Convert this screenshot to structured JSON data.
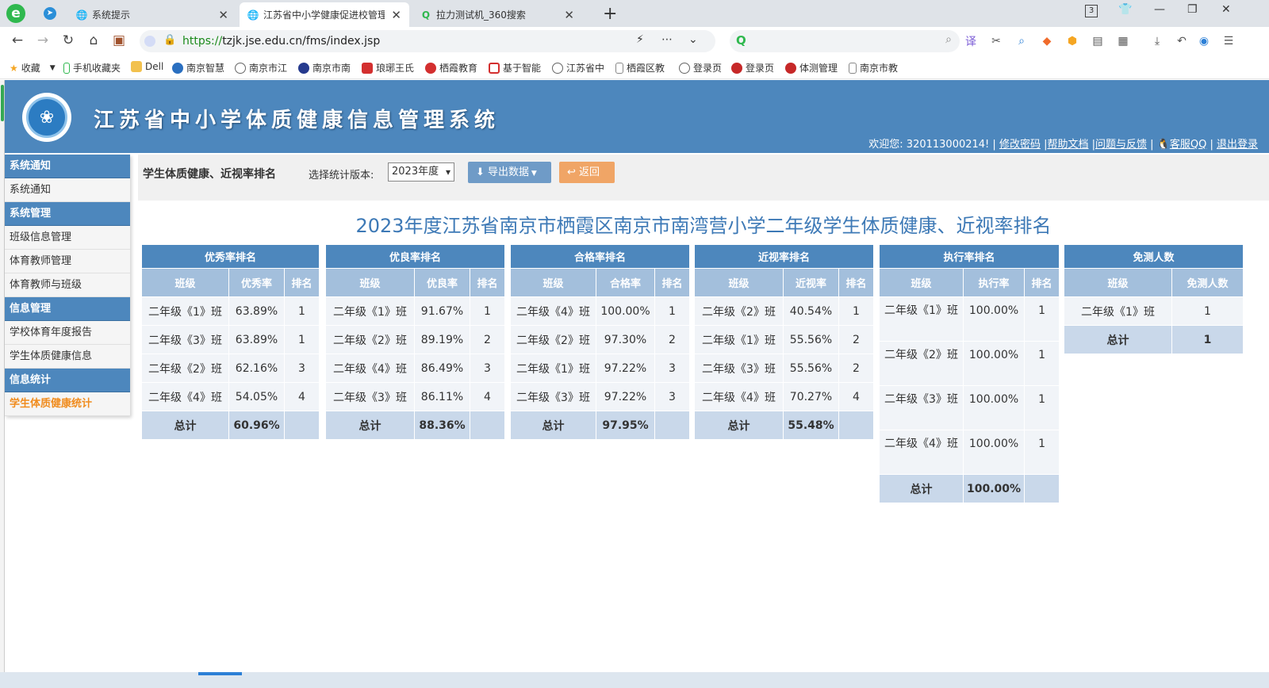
{
  "browser": {
    "tabs": [
      {
        "label": "系统提示",
        "icon": "globe-icon"
      },
      {
        "label": "江苏省中小学健康促进校管理",
        "icon": "globe-icon"
      },
      {
        "label": "拉力测试机_360搜索",
        "icon": "search-360-icon"
      }
    ],
    "tab_count": "3",
    "url_scheme": "https://",
    "url_rest": "tzjk.jse.edu.cn/fms/index.jsp",
    "bookmarks": [
      "收藏",
      "手机收藏夹",
      "Dell",
      "南京智慧",
      "南京市江",
      "南京市南",
      "琅琊王氏",
      "栖霞教育",
      "基于智能",
      "江苏省中",
      "栖霞区教",
      "登录页",
      "登录页",
      "体测管理",
      "南京市教"
    ]
  },
  "header": {
    "system_title": "江苏省中小学体质健康信息管理系统",
    "welcome": "欢迎您: 320113000214! |",
    "links": [
      "修改密码",
      "帮助文档",
      "问题与反馈",
      "客服QQ",
      "退出登录"
    ]
  },
  "sidebar": {
    "groups": [
      {
        "title": "系统通知",
        "items": [
          "系统通知"
        ]
      },
      {
        "title": "系统管理",
        "items": [
          "班级信息管理",
          "体育教师管理",
          "体育教师与班级"
        ]
      },
      {
        "title": "信息管理",
        "items": [
          "学校体育年度报告",
          "学生体质健康信息"
        ]
      },
      {
        "title": "信息统计",
        "items": [
          "学生体质健康统计"
        ]
      }
    ],
    "active_item": "学生体质健康统计"
  },
  "toolbar": {
    "title": "学生体质健康、近视率排名",
    "version_label": "选择统计版本:",
    "version_value": "2023年度",
    "export_label": "导出数据",
    "back_label": "返回"
  },
  "report": {
    "title": "2023年度江苏省南京市栖霞区南京市南湾营小学二年级学生体质健康、近视率排名",
    "tables": [
      {
        "caption": "优秀率排名",
        "headers": [
          "班级",
          "优秀率",
          "排名"
        ],
        "rows": [
          [
            "二年级《1》班",
            "63.89%",
            "1"
          ],
          [
            "二年级《3》班",
            "63.89%",
            "1"
          ],
          [
            "二年级《2》班",
            "62.16%",
            "3"
          ],
          [
            "二年级《4》班",
            "54.05%",
            "4"
          ]
        ],
        "total": [
          "总计",
          "60.96%",
          ""
        ]
      },
      {
        "caption": "优良率排名",
        "headers": [
          "班级",
          "优良率",
          "排名"
        ],
        "rows": [
          [
            "二年级《1》班",
            "91.67%",
            "1"
          ],
          [
            "二年级《2》班",
            "89.19%",
            "2"
          ],
          [
            "二年级《4》班",
            "86.49%",
            "3"
          ],
          [
            "二年级《3》班",
            "86.11%",
            "4"
          ]
        ],
        "total": [
          "总计",
          "88.36%",
          ""
        ]
      },
      {
        "caption": "合格率排名",
        "headers": [
          "班级",
          "合格率",
          "排名"
        ],
        "rows": [
          [
            "二年级《4》班",
            "100.00%",
            "1"
          ],
          [
            "二年级《2》班",
            "97.30%",
            "2"
          ],
          [
            "二年级《1》班",
            "97.22%",
            "3"
          ],
          [
            "二年级《3》班",
            "97.22%",
            "3"
          ]
        ],
        "total": [
          "总计",
          "97.95%",
          ""
        ]
      },
      {
        "caption": "近视率排名",
        "headers": [
          "班级",
          "近视率",
          "排名"
        ],
        "rows": [
          [
            "二年级《2》班",
            "40.54%",
            "1"
          ],
          [
            "二年级《1》班",
            "55.56%",
            "2"
          ],
          [
            "二年级《3》班",
            "55.56%",
            "2"
          ],
          [
            "二年级《4》班",
            "70.27%",
            "4"
          ]
        ],
        "total": [
          "总计",
          "55.48%",
          ""
        ]
      },
      {
        "caption": "执行率排名",
        "headers": [
          "班级",
          "执行率",
          "排名"
        ],
        "rows": [
          [
            "二年级《1》班",
            "100.00%",
            "1"
          ],
          [
            "二年级《2》班",
            "100.00%",
            "1"
          ],
          [
            "二年级《3》班",
            "100.00%",
            "1"
          ],
          [
            "二年级《4》班",
            "100.00%",
            "1"
          ]
        ],
        "total": [
          "总计",
          "100.00%",
          ""
        ]
      },
      {
        "caption": "免测人数",
        "headers": [
          "班级",
          "免测人数"
        ],
        "rows": [
          [
            "二年级《1》班",
            "1"
          ]
        ],
        "total": [
          "总计",
          "1"
        ]
      }
    ]
  }
}
